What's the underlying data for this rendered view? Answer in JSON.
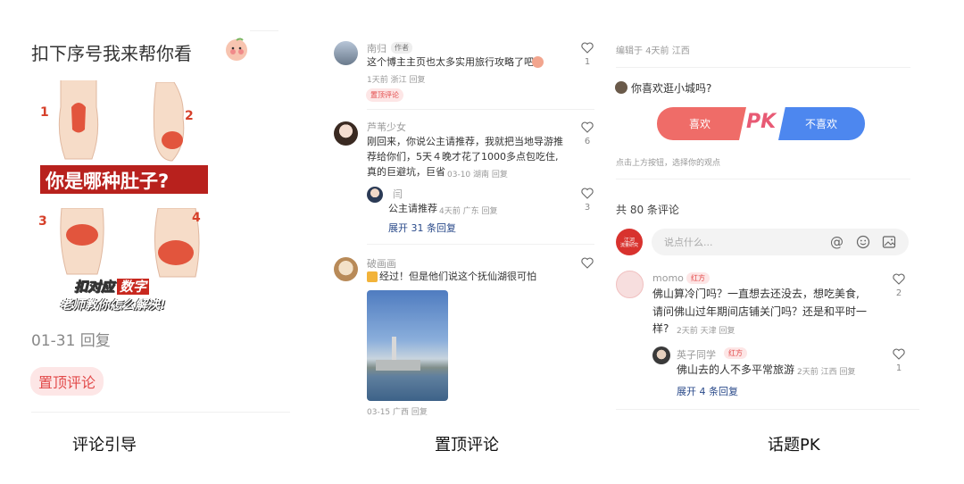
{
  "panel1": {
    "title": "扣下序号我来帮你看",
    "poster_headline": "你是哪种肚子?",
    "poster_line1_a": "扣对应",
    "poster_line1_b": "数字",
    "poster_line2": "老师教你怎么解决!",
    "numbers": [
      "1",
      "2",
      "3",
      "4"
    ],
    "date_reply": "01-31 回复",
    "pin_tag": "置顶评论",
    "caption": "评论引导"
  },
  "panel2": {
    "caption": "置顶评论",
    "comments": [
      {
        "name": "南归",
        "badge": "作者",
        "text": "这个博主主页也太多实用旅行攻略了吧",
        "meta": "1天前 浙江 回复",
        "pin_tag": "置顶评论",
        "likes": "1"
      },
      {
        "name": "芦苇少女",
        "text1": "刚回来，你说公主请推荐，我就把当地导游推",
        "text2": "荐给你们，5天４晚才花了1000多点包吃住,",
        "text3": "真的巨避坑，巨省",
        "meta": "03-10 湖南 回复",
        "likes": "6"
      },
      {
        "name": "闫",
        "text": "公主请推荐",
        "meta": "4天前 广东 回复",
        "likes": "3",
        "expand": "展开 31 条回复"
      },
      {
        "name": "破画画",
        "text": "经过！但是他们说这个抚仙湖很可怕",
        "meta": "03-15 广西 回复"
      }
    ]
  },
  "panel3": {
    "caption": "话题PK",
    "edited": "编辑于 4天前 江西",
    "question": "你喜欢逛小城吗?",
    "like_btn": "喜欢",
    "pk": "PK",
    "dislike_btn": "不喜欢",
    "hint": "点击上方按钮，选择你的观点",
    "total": "共 80 条评论",
    "avatar_text1": "江河",
    "avatar_text2": "流量研究",
    "input_placeholder": "说点什么...",
    "c1": {
      "name": "momo",
      "tag": "红方",
      "text1": "佛山算冷门吗？一直想去还没去，想吃美食,",
      "text2": "请问佛山过年期间店铺关门吗？还是和平时一",
      "text3": "样?",
      "meta": "2天前 天津 回复",
      "likes": "2"
    },
    "c2": {
      "name": "英子同学",
      "tag": "红方",
      "text": "佛山去的人不多平常旅游",
      "meta": "2天前 江西 回复",
      "likes": "1",
      "expand": "展开 4 条回复"
    }
  },
  "colors": {
    "red": "#f06a6a",
    "blue": "#4a86f0",
    "pink_tag": "#fde6e6"
  }
}
